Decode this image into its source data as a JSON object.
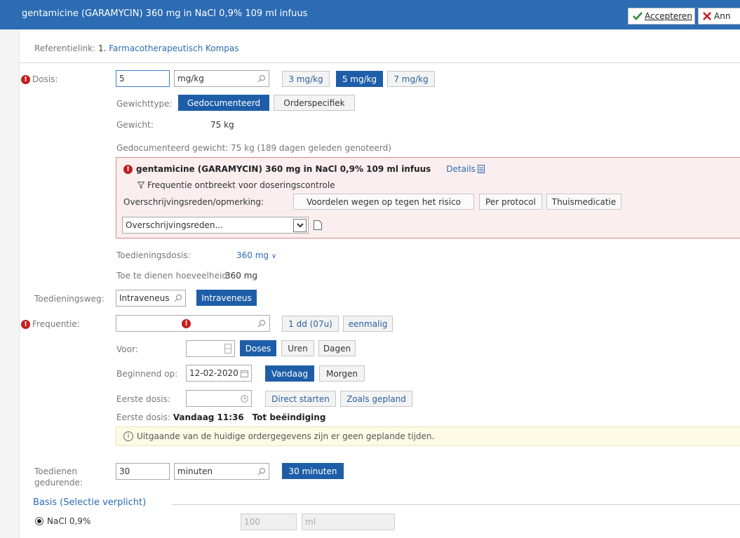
{
  "header": {
    "title": "gentamicine (GARAMYCIN) 360 mg in NaCl 0,9% 109 ml infuus",
    "accept_label": "Accepteren",
    "cancel_label": "Ann"
  },
  "reference": {
    "label": "Referentielink:",
    "link_number": "1.",
    "link_text": "Farmacotherapeutisch Kompas"
  },
  "dose": {
    "label": "Dosis:",
    "value": "5",
    "unit": "mg/kg",
    "options": [
      "3 mg/kg",
      "5 mg/kg",
      "7 mg/kg"
    ],
    "selected_option": "5 mg/kg",
    "weight_type_label": "Gewichttype:",
    "weight_types": [
      "Gedocumenteerd",
      "Orderspecifiek"
    ],
    "weight_label": "Gewicht:",
    "weight_value": "75 kg",
    "documented_weight": "Gedocumenteerd gewicht: 75 kg (189 dagen geleden genoteerd)"
  },
  "warning": {
    "title": "gentamicine (GARAMYCIN) 360 mg in NaCl 0,9% 109 ml infuus",
    "details_link": "Details",
    "message": "Frequentie ontbreekt voor doseringscontrole",
    "override_label": "Overschrijvingsreden/opmerking:",
    "override_options": [
      "Voordelen wegen op tegen het risico",
      "Per protocol",
      "Thuismedicatie"
    ],
    "override_select_placeholder": "Overschrijvingsreden..."
  },
  "admin_dose": {
    "label": "Toedieningsdosis:",
    "value": "360 mg",
    "amount_label": "Toe te dienen hoeveelheid:",
    "amount_value": "360 mg"
  },
  "route": {
    "label": "Toedieningsweg:",
    "value": "Intraveneus",
    "option": "Intraveneus"
  },
  "frequency": {
    "label": "Frequentie:",
    "options": [
      "1 dd (07u)",
      "eenmalig"
    ]
  },
  "duration": {
    "label": "Voor:",
    "units": [
      "Doses",
      "Uren",
      "Dagen"
    ],
    "selected_unit": "Doses"
  },
  "start": {
    "label": "Beginnend op:",
    "date": "12-02-2020",
    "options": [
      "Vandaag",
      "Morgen"
    ],
    "selected_option": "Vandaag"
  },
  "first_dose": {
    "label": "Eerste dosis:",
    "options": [
      "Direct starten",
      "Zoals gepland"
    ],
    "summary_label": "Eerste dosis:",
    "summary_value": "Vandaag 11:36",
    "end_text": "Tot beëindiging"
  },
  "info": {
    "message": "Uitgaande van de huidige ordergegevens zijn er geen geplande tijden."
  },
  "administer_over": {
    "label_line1": "Toedienen",
    "label_line2": "gedurende:",
    "value": "30",
    "unit": "minuten",
    "option": "30 minuten"
  },
  "basis": {
    "section_title": "Basis (Selectie verplicht)",
    "radio_label": "NaCl 0,9%",
    "volume_value": "100",
    "volume_unit": "ml"
  },
  "colors": {
    "accent": "#2b6cb3",
    "selected": "#1e5ea8",
    "error": "#c41d1d",
    "warning_bg": "#fbeeee",
    "info_bg": "#fdfbe5"
  }
}
